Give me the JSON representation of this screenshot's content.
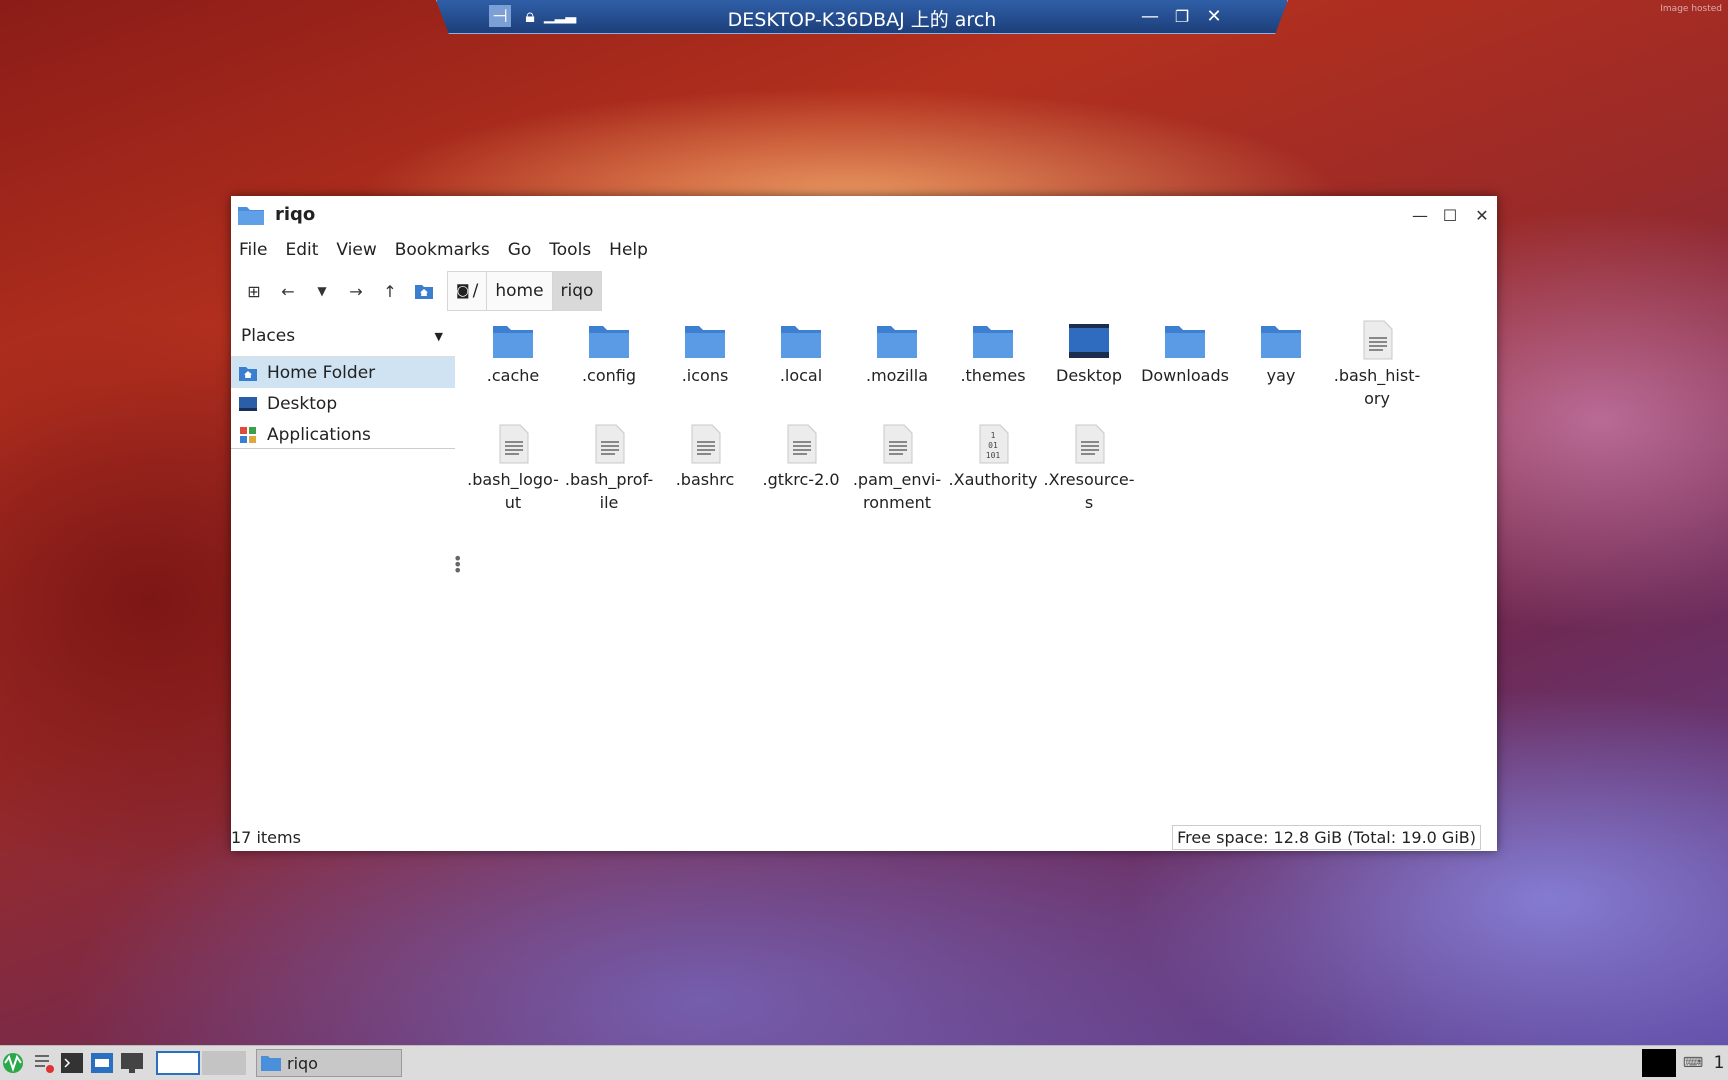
{
  "rdp": {
    "title": "DESKTOP-K36DBAJ 上的 arch",
    "tag": "Image hosted"
  },
  "window": {
    "title": "riqo",
    "menu": [
      "File",
      "Edit",
      "View",
      "Bookmarks",
      "Go",
      "Tools",
      "Help"
    ],
    "breadcrumbs": [
      "/",
      "home",
      "riqo"
    ]
  },
  "sidebar": {
    "header": "Places",
    "items": [
      "Home Folder",
      "Desktop",
      "Applications"
    ]
  },
  "files": [
    {
      "name": ".cache",
      "type": "folder"
    },
    {
      "name": ".config",
      "type": "folder"
    },
    {
      "name": ".icons",
      "type": "folder"
    },
    {
      "name": ".local",
      "type": "folder"
    },
    {
      "name": ".mozilla",
      "type": "folder"
    },
    {
      "name": ".themes",
      "type": "folder"
    },
    {
      "name": "Desktop",
      "type": "desktop"
    },
    {
      "name": "Downloads",
      "type": "folder"
    },
    {
      "name": "yay",
      "type": "folder"
    },
    {
      "name": ".bash_hist-\nory",
      "type": "text"
    },
    {
      "name": ".bash_logo-\nut",
      "type": "text"
    },
    {
      "name": ".bash_prof-\nile",
      "type": "text"
    },
    {
      "name": ".bashrc",
      "type": "text"
    },
    {
      "name": ".gtkrc-2.0",
      "type": "text"
    },
    {
      "name": ".pam_envi-\nronment",
      "type": "text"
    },
    {
      "name": ".Xauthority",
      "type": "binary"
    },
    {
      "name": ".Xresource-\ns",
      "type": "text"
    }
  ],
  "status": {
    "count": "17 items",
    "free": "Free space: 12.8 GiB (Total: 19.0 GiB)"
  },
  "taskbar": {
    "task_label": "riqo",
    "clock_partial": "1"
  },
  "colors": {
    "folder": "#4a8fd9",
    "selection": "#cfe3f3"
  }
}
